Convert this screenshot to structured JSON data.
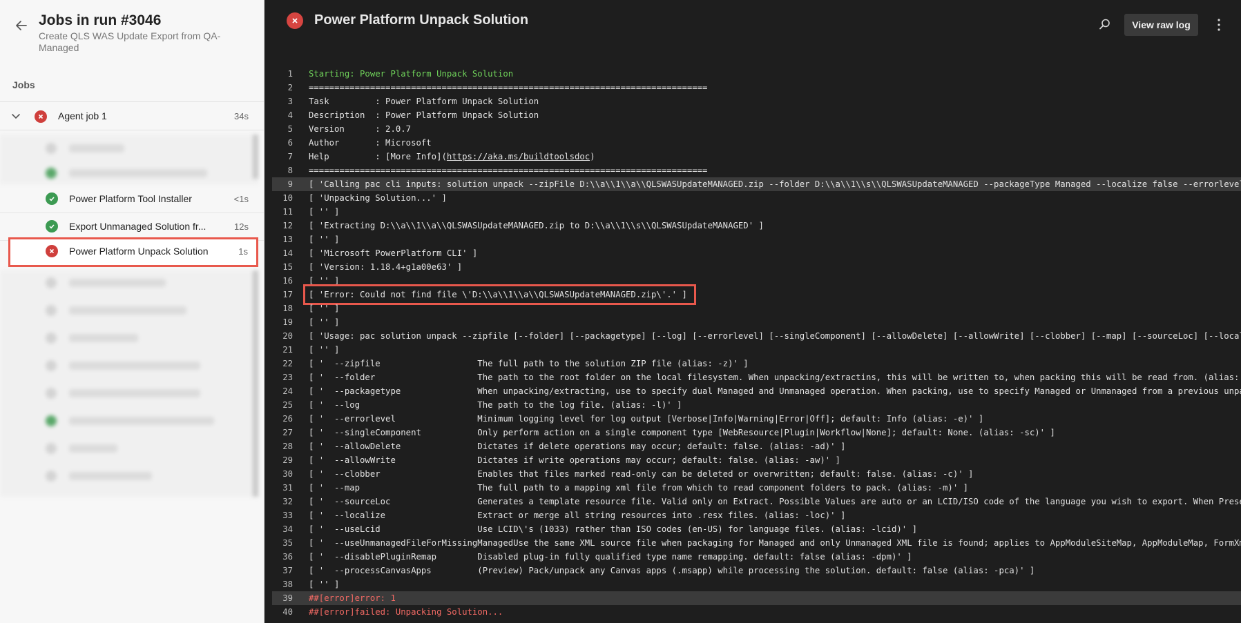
{
  "left_panel": {
    "run_title": "Jobs in run #3046",
    "run_subtitle": "Create QLS WAS Update Export from QA-Managed",
    "jobs_header": "Jobs",
    "agent_job": {
      "label": "Agent job 1",
      "duration": "34s",
      "status": "failed"
    },
    "steps": [
      {
        "label": "Power Platform Tool Installer",
        "duration": "<1s",
        "status": "succeeded"
      },
      {
        "label": "Export Unmanaged Solution fr...",
        "duration": "12s",
        "status": "succeeded"
      },
      {
        "label": "Power Platform Unpack Solution",
        "duration": "1s",
        "status": "failed",
        "selected": true
      }
    ]
  },
  "log_panel": {
    "title": "Power Platform Unpack Solution",
    "view_raw_label": "View raw log",
    "lines": [
      {
        "no": "1",
        "text": "Starting: Power Platform Unpack Solution",
        "style": "green"
      },
      {
        "no": "2",
        "text": "==============================================================================",
        "style": ""
      },
      {
        "no": "3",
        "text": "Task         : Power Platform Unpack Solution",
        "style": ""
      },
      {
        "no": "4",
        "text": "Description  : Power Platform Unpack Solution",
        "style": ""
      },
      {
        "no": "5",
        "text": "Version      : 2.0.7",
        "style": ""
      },
      {
        "no": "6",
        "text": "Author       : Microsoft",
        "style": ""
      },
      {
        "no": "7",
        "text": "Help         : [More Info](",
        "link": "https://aka.ms/buildtoolsdoc",
        "after": ")",
        "style": ""
      },
      {
        "no": "8",
        "text": "==============================================================================",
        "style": ""
      },
      {
        "no": "9",
        "text": "[ 'Calling pac cli inputs: solution unpack --zipFile D:\\\\a\\\\1\\\\a\\\\QLSWASUpdateMANAGED.zip --folder D:\\\\a\\\\1\\\\s\\\\QLSWASUpdateMANAGED --packageType Managed --localize false --errorlevel In",
        "style": "hl"
      },
      {
        "no": "10",
        "text": "[ 'Unpacking Solution...' ]",
        "style": ""
      },
      {
        "no": "11",
        "text": "[ '' ]",
        "style": ""
      },
      {
        "no": "12",
        "text": "[ 'Extracting D:\\\\a\\\\1\\\\a\\\\QLSWASUpdateMANAGED.zip to D:\\\\a\\\\1\\\\s\\\\QLSWASUpdateMANAGED' ]",
        "style": ""
      },
      {
        "no": "13",
        "text": "[ '' ]",
        "style": ""
      },
      {
        "no": "14",
        "text": "[ 'Microsoft PowerPlatform CLI' ]",
        "style": ""
      },
      {
        "no": "15",
        "text": "[ 'Version: 1.18.4+g1a00e63' ]",
        "style": ""
      },
      {
        "no": "16",
        "text": "[ '' ]",
        "style": ""
      },
      {
        "no": "17",
        "text": "[ 'Error: Could not find file \\'D:\\\\a\\\\1\\\\a\\\\QLSWASUpdateMANAGED.zip\\'.' ]",
        "style": "boxed"
      },
      {
        "no": "18",
        "text": "[ '' ]",
        "style": ""
      },
      {
        "no": "19",
        "text": "[ '' ]",
        "style": ""
      },
      {
        "no": "20",
        "text": "[ 'Usage: pac solution unpack --zipfile [--folder] [--packagetype] [--log] [--errorlevel] [--singleComponent] [--allowDelete] [--allowWrite] [--clobber] [--map] [--sourceLoc] [--localize",
        "style": ""
      },
      {
        "no": "21",
        "text": "[ '' ]",
        "style": ""
      },
      {
        "no": "22",
        "text": "[ '  --zipfile                   The full path to the solution ZIP file (alias: -z)' ]",
        "style": ""
      },
      {
        "no": "23",
        "text": "[ '  --folder                    The path to the root folder on the local filesystem. When unpacking/extractins, this will be written to, when packing this will be read from. (alias: -f)",
        "style": ""
      },
      {
        "no": "24",
        "text": "[ '  --packagetype               When unpacking/extracting, use to specify dual Managed and Unmanaged operation. When packing, use to specify Managed or Unmanaged from a previous unpack",
        "style": ""
      },
      {
        "no": "25",
        "text": "[ '  --log                       The path to the log file. (alias: -l)' ]",
        "style": ""
      },
      {
        "no": "26",
        "text": "[ '  --errorlevel                Minimum logging level for log output [Verbose|Info|Warning|Error|Off]; default: Info (alias: -e)' ]",
        "style": ""
      },
      {
        "no": "27",
        "text": "[ '  --singleComponent           Only perform action on a single component type [WebResource|Plugin|Workflow|None]; default: None. (alias: -sc)' ]",
        "style": ""
      },
      {
        "no": "28",
        "text": "[ '  --allowDelete               Dictates if delete operations may occur; default: false. (alias: -ad)' ]",
        "style": ""
      },
      {
        "no": "29",
        "text": "[ '  --allowWrite                Dictates if write operations may occur; default: false. (alias: -aw)' ]",
        "style": ""
      },
      {
        "no": "30",
        "text": "[ '  --clobber                   Enables that files marked read-only can be deleted or overwritten; default: false. (alias: -c)' ]",
        "style": ""
      },
      {
        "no": "31",
        "text": "[ '  --map                       The full path to a mapping xml file from which to read component folders to pack. (alias: -m)' ]",
        "style": ""
      },
      {
        "no": "32",
        "text": "[ '  --sourceLoc                 Generates a template resource file. Valid only on Extract. Possible Values are auto or an LCID/ISO code of the language you wish to export. When Present,",
        "style": ""
      },
      {
        "no": "33",
        "text": "[ '  --localize                  Extract or merge all string resources into .resx files. (alias: -loc)' ]",
        "style": ""
      },
      {
        "no": "34",
        "text": "[ '  --useLcid                   Use LCID\\'s (1033) rather than ISO codes (en-US) for language files. (alias: -lcid)' ]",
        "style": ""
      },
      {
        "no": "35",
        "text": "[ '  --useUnmanagedFileForMissingManagedUse the same XML source file when packaging for Managed and only Unmanaged XML file is found; applies to AppModuleSiteMap, AppModuleMap, FormXml f",
        "style": ""
      },
      {
        "no": "36",
        "text": "[ '  --disablePluginRemap        Disabled plug-in fully qualified type name remapping. default: false (alias: -dpm)' ]",
        "style": ""
      },
      {
        "no": "37",
        "text": "[ '  --processCanvasApps         (Preview) Pack/unpack any Canvas apps (.msapp) while processing the solution. default: false (alias: -pca)' ]",
        "style": ""
      },
      {
        "no": "38",
        "text": "[ '' ]",
        "style": ""
      },
      {
        "no": "39",
        "text": "##[error]error: 1",
        "style": "red hl"
      },
      {
        "no": "40",
        "text": "##[error]failed: Unpacking Solution...",
        "style": "red"
      }
    ]
  },
  "icons": {
    "back": "arrow-left-icon",
    "search": "search-icon",
    "more": "more-vertical-icon",
    "failed": "x-circle-icon",
    "succeeded": "check-circle-icon"
  },
  "colors": {
    "failed": "#cf3f3c",
    "succeeded": "#3c9a52",
    "highlight_box": "#e8584c",
    "log_green": "#6fd15a",
    "log_red": "#f26a64"
  }
}
